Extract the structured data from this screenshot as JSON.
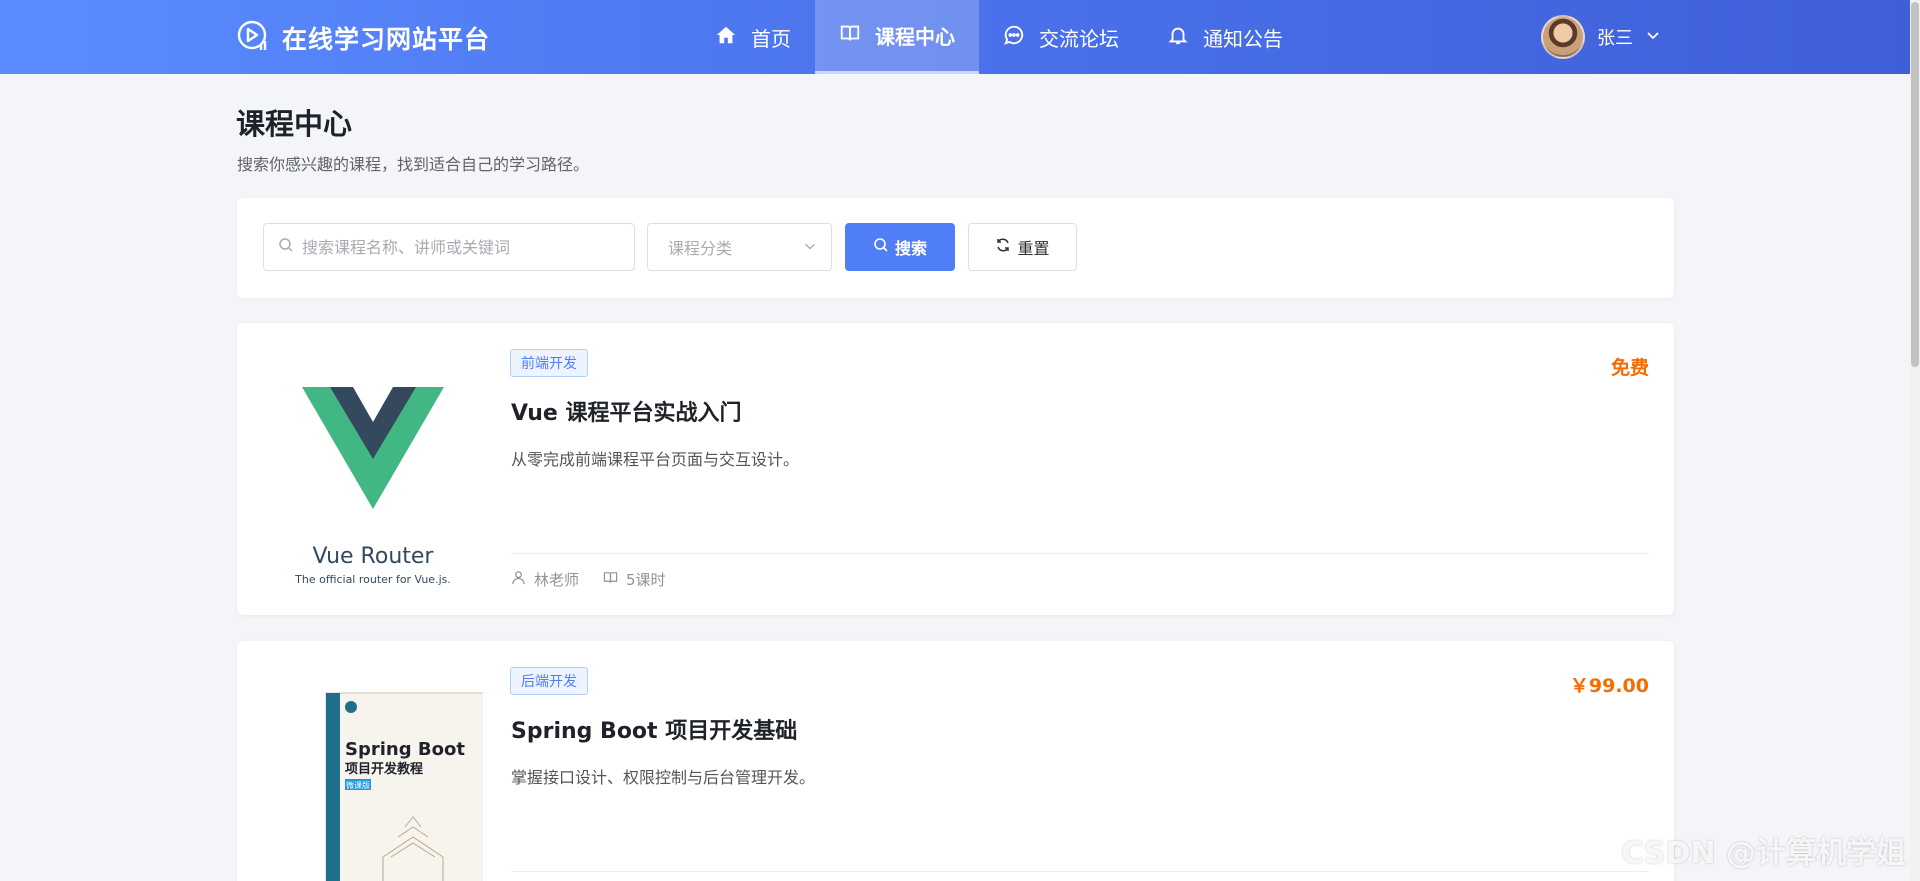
{
  "header": {
    "brand_title": "在线学习网站平台",
    "nav": [
      {
        "label": "首页",
        "icon": "home-icon",
        "active": false
      },
      {
        "label": "课程中心",
        "icon": "book-icon",
        "active": true
      },
      {
        "label": "交流论坛",
        "icon": "chat-icon",
        "active": false
      },
      {
        "label": "通知公告",
        "icon": "bell-icon",
        "active": false
      }
    ],
    "user_name": "张三"
  },
  "page": {
    "title": "课程中心",
    "subtitle": "搜索你感兴趣的课程，找到适合自己的学习路径。"
  },
  "search": {
    "placeholder": "搜索课程名称、讲师或关键词",
    "value": "",
    "category_placeholder": "课程分类",
    "search_label": "搜索",
    "reset_label": "重置"
  },
  "courses": [
    {
      "tag": "前端开发",
      "title": "Vue 课程平台实战入门",
      "description": "从零完成前端课程平台页面与交互设计。",
      "price": "免费",
      "teacher": "林老师",
      "lessons": "5课时",
      "cover": {
        "logo_name": "Vue Router",
        "logo_sub": "The official router for Vue.js."
      }
    },
    {
      "tag": "后端开发",
      "title": "Spring Boot 项目开发基础",
      "description": "掌握接口设计、权限控制与后台管理开发。",
      "price": "￥99.00",
      "cover": {
        "book_title": "Spring Boot",
        "book_subtitle": "项目开发教程",
        "book_badge": "微课版"
      }
    }
  ],
  "watermark": "CSDN @计算机学姐",
  "colors": {
    "primary": "#4f7ef8",
    "price": "#f56c00",
    "header_start": "#5b8cff",
    "header_end": "#3f5fd8"
  }
}
